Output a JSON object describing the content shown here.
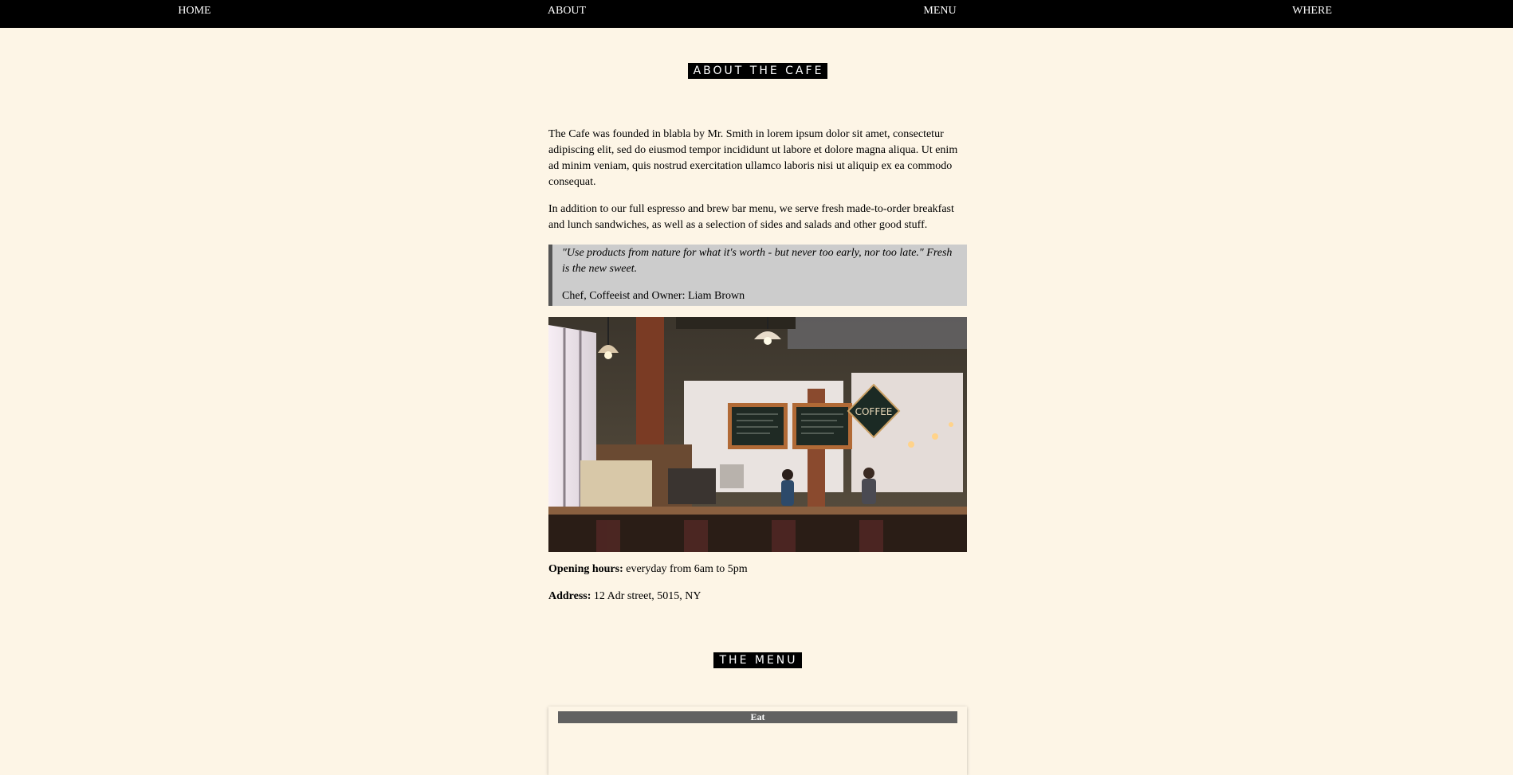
{
  "nav": {
    "items": [
      {
        "label": "HOME"
      },
      {
        "label": "ABOUT"
      },
      {
        "label": "MENU"
      },
      {
        "label": "WHERE"
      }
    ]
  },
  "about": {
    "heading": "ABOUT THE CAFE",
    "paragraph1": "The Cafe was founded in blabla by Mr. Smith in lorem ipsum dolor sit amet, consectetur adipiscing elit, sed do eiusmod tempor incididunt ut labore et dolore magna aliqua. Ut enim ad minim veniam, quis nostrud exercitation ullamco laboris nisi ut aliquip ex ea commodo consequat.",
    "paragraph2": "In addition to our full espresso and brew bar menu, we serve fresh made-to-order breakfast and lunch sandwiches, as well as a selection of sides and salads and other good stuff.",
    "quote": {
      "text": "\"Use products from nature for what it's worth - but never too early, nor too late.\" Fresh is the new sweet.",
      "author": "Chef, Coffeeist and Owner: Liam Brown"
    },
    "photo_sign": "COFFEE",
    "opening_hours_label": "Opening hours:",
    "opening_hours_value": " everyday from 6am to 5pm",
    "address_label": "Address:",
    "address_value": " 12 Adr street, 5015, NY"
  },
  "menu": {
    "heading": "THE MENU",
    "tabs": [
      {
        "label": "Eat"
      }
    ]
  },
  "colors": {
    "background": "#fdf5e6",
    "nav_background": "#000000",
    "quote_background": "#cccccc",
    "quote_border": "#555555",
    "menu_tab": "#616161"
  }
}
